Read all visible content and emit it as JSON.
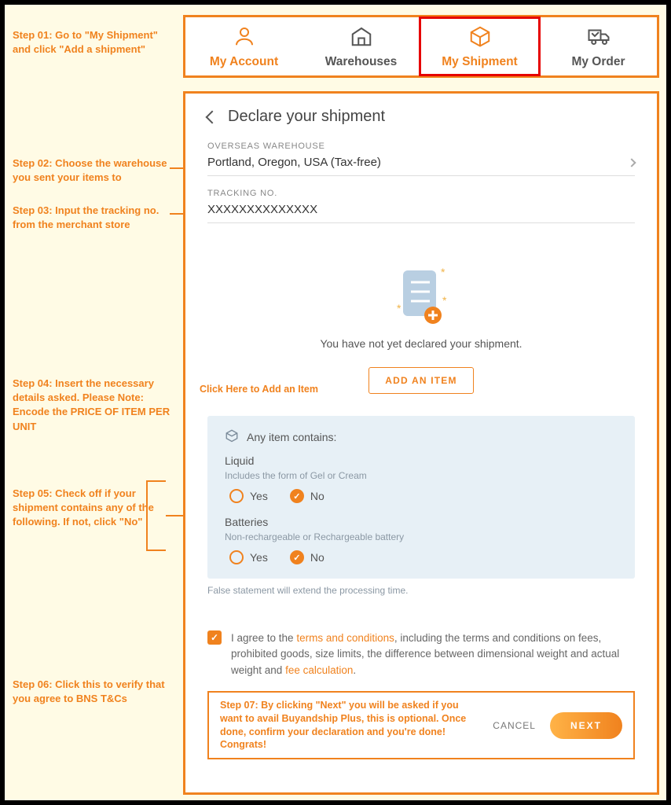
{
  "steps": {
    "s1": "Step 01: Go to \"My Shipment\" and click \"Add a shipment\"",
    "s2": "Step 02: Choose the warehouse you sent your items to",
    "s3": "Step 03: Input the tracking no. from the merchant store",
    "s4": "Step 04: Insert the necessary details asked. Please Note: Encode the PRICE OF ITEM PER UNIT",
    "s5": "Step 05: Check off if your shipment contains any of the following. If not, click \"No\"",
    "s6": "Step 06: Click this to verify that you agree to BNS T&Cs",
    "s7": "Step 07: By clicking \"Next\" you will be asked if you want to avail Buyandship Plus, this is optional. Once done, confirm your declaration and you're done! Congrats!"
  },
  "tabs": {
    "account": "My Account",
    "warehouses": "Warehouses",
    "shipment": "My Shipment",
    "order": "My Order"
  },
  "main": {
    "title": "Declare your shipment",
    "warehouse_label": "OVERSEAS WAREHOUSE",
    "warehouse_value": "Portland, Oregon, USA (Tax-free)",
    "tracking_label": "TRACKING NO.",
    "tracking_value": "XXXXXXXXXXXXXX",
    "empty_msg": "You have not yet declared your shipment.",
    "add_item_btn": "ADD AN ITEM",
    "add_item_inline": "Click Here to Add an Item",
    "contains": {
      "header": "Any item contains:",
      "liquid_label": "Liquid",
      "liquid_sub": "Includes the form of Gel or Cream",
      "batteries_label": "Batteries",
      "batteries_sub": "Non-rechargeable or Rechargeable battery",
      "yes": "Yes",
      "no": "No",
      "footnote": "False statement will extend the processing time."
    },
    "agree_pre": "I agree to the ",
    "agree_link1": "terms and conditions",
    "agree_mid": ", including the terms and conditions on fees, prohibited goods, size limits, the difference between dimensional weight and actual weight and ",
    "agree_link2": "fee calculation",
    "agree_post": ".",
    "cancel": "CANCEL",
    "next": "NEXT"
  },
  "colors": {
    "accent": "#f0821e",
    "red": "#e60000"
  }
}
